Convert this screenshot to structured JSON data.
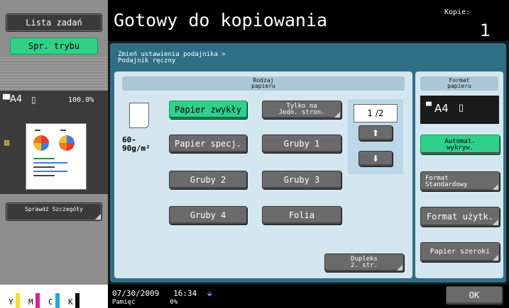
{
  "left": {
    "job_list_btn": "Lista zadań",
    "check_mode_btn": "Spr. trybu",
    "paper_size": "A4",
    "zoom": "100.0%",
    "details_btn": "Sprawdź Szczegóły",
    "toner": [
      "Y",
      "M",
      "C",
      "K"
    ]
  },
  "header": {
    "status": "Gotowy do kopiowania",
    "copies_label": "Kopie:",
    "copies_value": "1"
  },
  "breadcrumb": {
    "line1": "Zmień ustawienia podajnika >",
    "line2": "Podajnik ręczny"
  },
  "paper_type": {
    "title_line1": "Rodzaj",
    "title_line2": "papieru",
    "weight_line1": "60-",
    "weight_line2": "90g/m²",
    "buttons": {
      "plain": "Papier zwykły",
      "single_line1": "Tylko na",
      "single_line2": "Jedn. stron.",
      "special": "Papier specj.",
      "thick1": "Gruby 1",
      "thick2": "Gruby 2",
      "thick3": "Gruby 3",
      "thick4": "Gruby 4",
      "film": "Folia",
      "duplex_line1": "Dupleks",
      "duplex_line2": "2. str."
    },
    "page_indicator": "1 /2"
  },
  "paper_format": {
    "title_line1": "Format",
    "title_line2": "papieru",
    "current": "A4",
    "auto_line1": "Automat.",
    "auto_line2": "wykryw.",
    "standard_line1": "Format",
    "standard_line2": "Standardowy",
    "custom": "Format użytk.",
    "wide": "Papier szeroki"
  },
  "footer": {
    "date": "07/30/2009",
    "time": "16:34",
    "memory_label": "Pamięć",
    "memory_value": "0%",
    "ok": "OK"
  },
  "colors": {
    "accent": "#2fd08a",
    "panel_bg": "#2f6f86",
    "button_gray": "#6a6a6a"
  }
}
